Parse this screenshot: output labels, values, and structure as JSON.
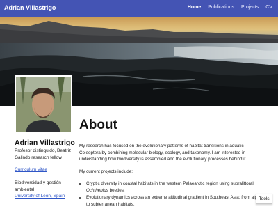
{
  "navbar": {
    "brand": "Adrian Villastrigo",
    "links": [
      {
        "label": "Home"
      },
      {
        "label": "Publications"
      },
      {
        "label": "Projects"
      },
      {
        "label": "CV"
      }
    ]
  },
  "sidebar": {
    "name": "Adrian Villastrigo",
    "role": "Profesor distinguido, Beatriz Galindo research fellow",
    "cv_link": "Curriculum vitae",
    "affiliation_title": "Biodiversidad y gestión ambiental",
    "affiliation_link": "University of León, Spain"
  },
  "main": {
    "title": "About",
    "intro": "My research has focused on the evolutionary patterns of habitat transitions in aquatic Coleoptera by combining molecular biology, ecology, and taxonomy. I am interested in understanding how biodiversity is assembled and the evolutionary processes behind it.",
    "projects_heading": "My current projects include:",
    "projects": [
      {
        "before": "Cryptic diversity in coastal habitats in the western Palaearctic region using supralittoral ",
        "italic": "Ochthebius",
        "after": " beetles."
      },
      {
        "before": "Evolutionary dynamics across an extreme altitudinal gradient in Southeast Asia: from alpine to subterranean habitats.",
        "italic": "",
        "after": ""
      }
    ]
  },
  "tools": {
    "label": "Tools"
  },
  "colors": {
    "navbar": "#4454b4",
    "link": "#2f56c7"
  }
}
